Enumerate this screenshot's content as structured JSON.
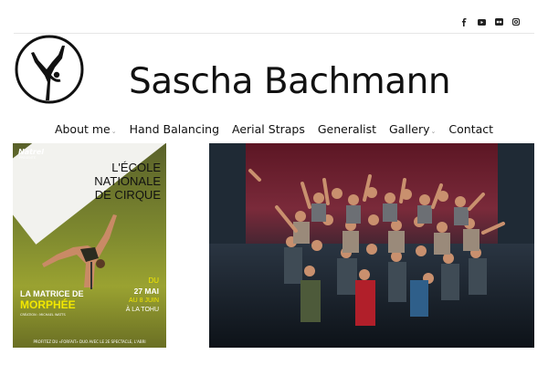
{
  "header": {
    "site_title": "Sascha Bachmann",
    "social_icons": [
      "facebook-icon",
      "youtube-icon",
      "flickr-icon",
      "instagram-icon"
    ]
  },
  "nav": {
    "items": [
      {
        "label": "About me",
        "has_dropdown": true
      },
      {
        "label": "Hand Balancing",
        "has_dropdown": false
      },
      {
        "label": "Aerial Straps",
        "has_dropdown": false
      },
      {
        "label": "Generalist",
        "has_dropdown": false
      },
      {
        "label": "Gallery",
        "has_dropdown": true
      },
      {
        "label": "Contact",
        "has_dropdown": false
      }
    ],
    "caret": "⌄"
  },
  "poster": {
    "brand": "Natrel",
    "brand_sub": "PRÉSENTE",
    "title_line1": "L'ÉCOLE",
    "title_line2": "NATIONALE",
    "title_line3": "DE CIRQUE",
    "show_line1": "LA MATRICE DE",
    "show_line2": "MORPHÉE",
    "credit": "CRÉATION : MICHAEL WATTS",
    "date_line1": "DU",
    "date_line2": "27 MAI",
    "date_line3": "AU 8 JUIN",
    "date_line4": "À LA TOHU",
    "footer": "PROFITEZ DU «FORFAIT» DUO AVEC LE 2E SPECTACLE, L'ABRI"
  },
  "colors": {
    "poster_yellow": "#f2e700",
    "poster_olive": "#7f8a2f",
    "stage_backdrop": "#6e1f2a"
  }
}
